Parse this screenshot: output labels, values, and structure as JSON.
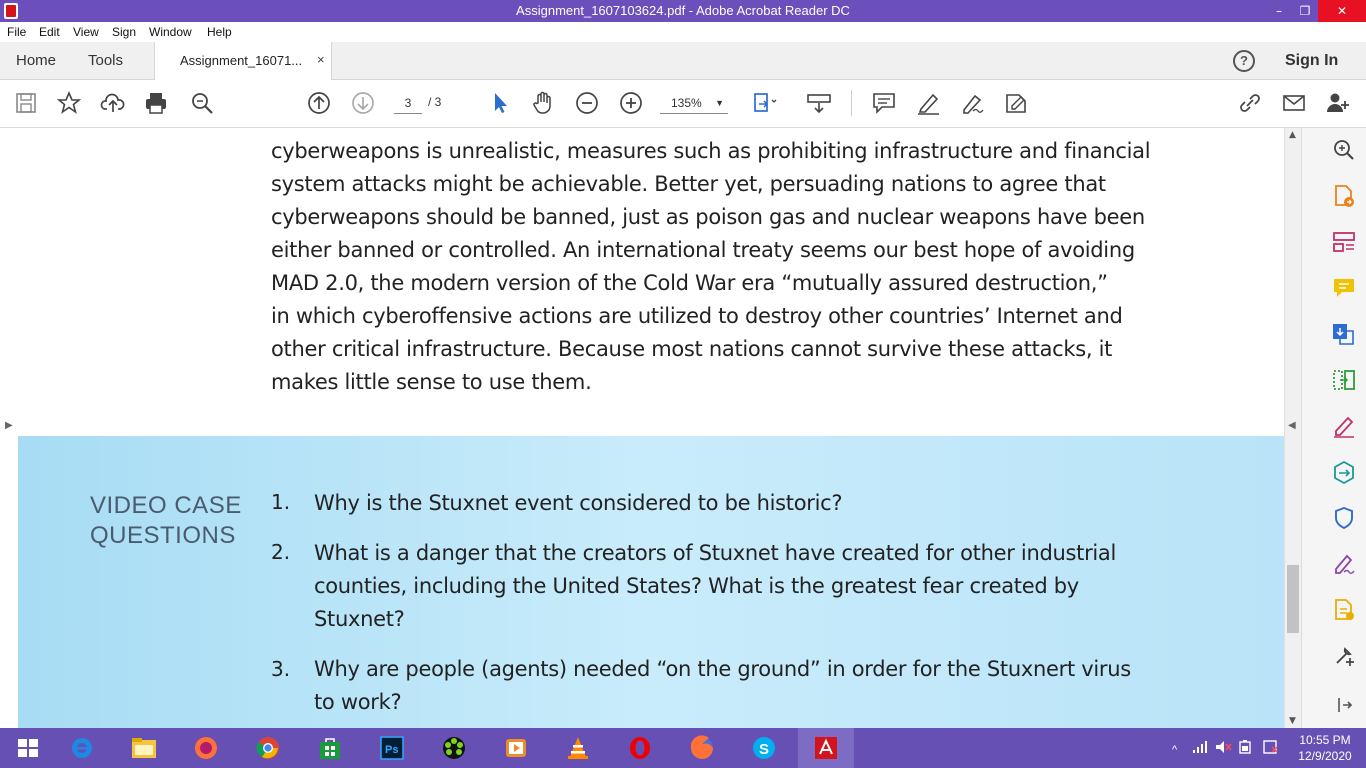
{
  "window": {
    "title": "Assignment_1607103624.pdf - Adobe Acrobat Reader DC",
    "minimize_glyph": "–",
    "maximize_glyph": "❐",
    "close_glyph": "✕"
  },
  "menu": [
    "File",
    "Edit",
    "View",
    "Sign",
    "Window",
    "Help"
  ],
  "tabs": {
    "home": "Home",
    "tools": "Tools",
    "document": "Assignment_16071...",
    "close_glyph": "×",
    "help_glyph": "?",
    "sign_in": "Sign In"
  },
  "toolbar": {
    "current_page": "3",
    "total_pages": "/ 3",
    "zoom": "135%",
    "zoom_caret": "▼"
  },
  "document": {
    "body_lines": [
      "cyberweapons is unrealistic, measures such as prohibiting infrastructure and financial",
      "system attacks might be achievable. Better yet, persuading nations to agree that",
      "cyberweapons should be banned, just as poison gas and nuclear weapons have been",
      "either banned or controlled. An international treaty seems our best hope of avoiding",
      "MAD 2.0, the modern version of the Cold War era “mutually assured destruction,”",
      "in which cyberoffensive actions are utilized to destroy other countries’ Internet and",
      "other critical infrastructure. Because most nations cannot survive these attacks, it",
      "makes little sense to use them."
    ],
    "heading_line1": "VIDEO  CASE",
    "heading_line2": "QUESTIONS",
    "questions": [
      {
        "num": "1.",
        "lines": [
          "Why is the Stuxnet event considered to be historic?"
        ]
      },
      {
        "num": "2.",
        "lines": [
          "What is a danger that the creators of Stuxnet have created for other industrial",
          "counties, including the United States? What is the greatest fear created by",
          "Stuxnet?"
        ]
      },
      {
        "num": "3.",
        "lines": [
          "Why are people (agents) needed “on the ground” in order for the Stuxnert virus",
          "to work?"
        ]
      }
    ]
  },
  "scroll": {
    "up": "▲",
    "down": "▼",
    "left_expand": "▶",
    "right_collapse": "◀"
  },
  "taskbar": {
    "clock_time": "10:55 PM",
    "clock_date": "12/9/2020",
    "tray_caret": "^"
  },
  "colors": {
    "titlebar": "#6b4fbb",
    "taskbar": "#6650b3",
    "accent_orange": "#e8841b",
    "accent_pink": "#c1306b",
    "accent_green": "#2f9e3a",
    "accent_teal": "#1a9b95",
    "accent_blue": "#2d6cd1"
  }
}
